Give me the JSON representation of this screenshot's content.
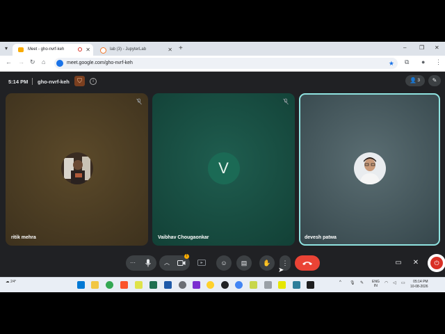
{
  "browser": {
    "tabs": [
      {
        "label": "Meet - gho-nvrf-keh",
        "active": true
      },
      {
        "label": "lab (3) - JupyterLab",
        "active": false
      }
    ],
    "new_tab": "+",
    "window_controls": {
      "minimize": "–",
      "maximize": "❐",
      "close": "✕"
    },
    "url": "meet.google.com/gho-nvrf-keh"
  },
  "meet": {
    "time": "5:14 PM",
    "meeting_code": "gho-nvrf-keh",
    "people_count": "3",
    "participants": [
      {
        "name": "ritik mehra",
        "muted": true,
        "avatar": "photo",
        "tile_color": "#3d311d"
      },
      {
        "name": "Vaibhav Chougaonkar",
        "muted": true,
        "avatar_letter": "V",
        "tile_color": "#124036"
      },
      {
        "name": "devesh patwa",
        "muted": false,
        "avatar": "photo",
        "active_speaker": true,
        "tile_color": "#35464b"
      }
    ],
    "controls": {
      "more_dots": "···",
      "mic": "mic-icon",
      "camera_warning": "!"
    }
  },
  "taskbar": {
    "weather": "24°",
    "lang_line1": "ENG",
    "lang_line2": "IN",
    "clock_time": "05:14 PM",
    "clock_date": "10-08-2026"
  },
  "colors": {
    "end_call": "#ea4335",
    "accent_blue": "#1a73e8",
    "speaker_border": "#8fe3e0"
  }
}
